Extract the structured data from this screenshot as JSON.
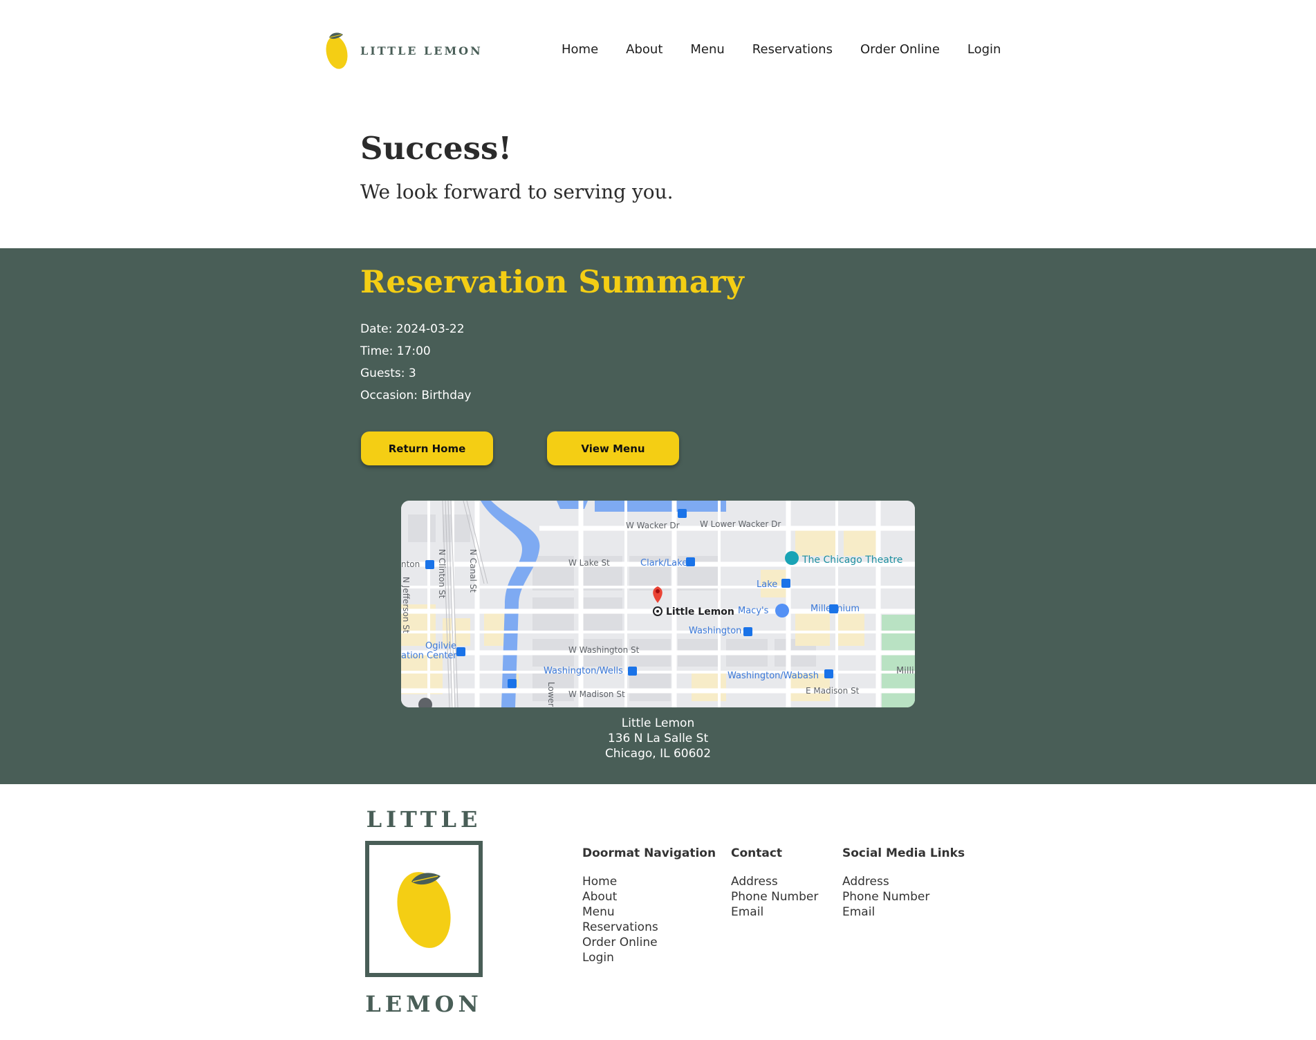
{
  "brand": {
    "name": "LITTLE LEMON",
    "footer_top": "LITTLE",
    "footer_bottom": "LEMON"
  },
  "nav": {
    "items": [
      {
        "label": "Home"
      },
      {
        "label": "About"
      },
      {
        "label": "Menu"
      },
      {
        "label": "Reservations"
      },
      {
        "label": "Order Online"
      },
      {
        "label": "Login"
      }
    ]
  },
  "hero": {
    "title": "Success!",
    "subtitle": "We look forward to serving you."
  },
  "summary": {
    "title": "Reservation Summary",
    "date": "Date: 2024-03-22",
    "time": "Time: 17:00",
    "guests": "Guests: 3",
    "occasion": "Occasion: Birthday",
    "return_home_label": "Return Home",
    "view_menu_label": "View Menu"
  },
  "map": {
    "place_label": "Little Lemon",
    "streets": [
      "W Wacker Dr",
      "W Lower Wacker Dr",
      "W Lake St",
      "Clark/Lake",
      "The Chicago Theatre",
      "Lake",
      "Macy's",
      "Millennium",
      "Washington",
      "W Washington St",
      "Washington/Wells",
      "Washington/Wabash",
      "W Madison St",
      "E Madison St",
      "Ogilvie",
      "ation Center",
      "N Canal St",
      "N Clinton St",
      "N Jefferson St",
      "nton",
      "Lower",
      "Milli"
    ]
  },
  "address": {
    "name": "Little Lemon",
    "street": "136 N La Salle St",
    "city": "Chicago, IL 60602"
  },
  "footer": {
    "columns": [
      {
        "heading": "Doormat Navigation",
        "links": [
          "Home",
          "About",
          "Menu",
          "Reservations",
          "Order Online",
          "Login"
        ]
      },
      {
        "heading": "Contact",
        "links": [
          "Address",
          "Phone Number",
          "Email"
        ]
      },
      {
        "heading": "Social Media Links",
        "links": [
          "Address",
          "Phone Number",
          "Email"
        ]
      }
    ]
  },
  "colors": {
    "primary_green": "#495e57",
    "primary_yellow": "#f4ce14",
    "white": "#ffffff"
  }
}
